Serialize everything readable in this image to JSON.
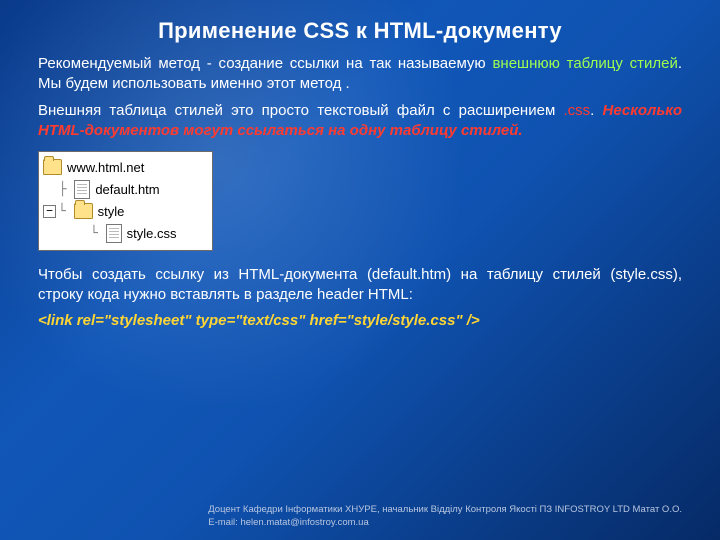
{
  "title": "Применение CSS к HTML-документу",
  "p1": {
    "a": "Рекомендуемый метод - создание ссылки на так называемую ",
    "b": "внешнюю таблицу стилей",
    "c": ". Мы будем использовать именно этот метод ."
  },
  "p2": {
    "a": "Внешняя таблица стилей это просто текстовый файл с расширением ",
    "b": ".css",
    "c": ". ",
    "d": "Несколько HTML-документов могут ссылаться на одну таблицу стилей."
  },
  "tree": {
    "root": "www.html.net",
    "file1": "default.htm",
    "folder": "style",
    "file2": "style.css",
    "expander": "−"
  },
  "p3": "Чтобы создать ссылку из HTML-документа (default.htm) на таблицу стилей (style.css), строку кода нужно вставлять в разделе header HTML:",
  "code": "<link rel=\"stylesheet\" type=\"text/css\" href=\"style/style.css\" />",
  "footer": "Доцент Кафедри Інформатики ХНУРЕ, начальник Відділу Контроля Якості ПЗ INFOSTROY LTD Матат О.О.\nE-mail:  helen.matat@infostroy.com.ua"
}
